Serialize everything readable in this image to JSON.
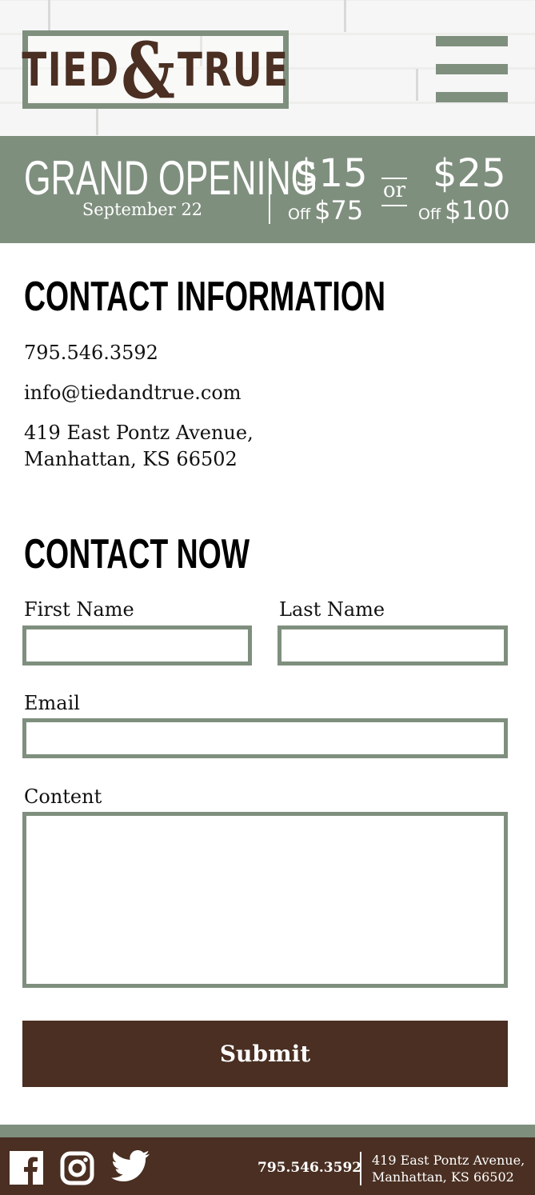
{
  "brand": {
    "logo_text_left": "TIED",
    "logo_amp": "&",
    "logo_text_right": "TRUE",
    "brown": "#4a2f22",
    "sage": "#7f8f7e"
  },
  "header": {
    "menu_icon": "hamburger-menu-icon"
  },
  "promo": {
    "title": "GRAND OPENING",
    "date": "September 22",
    "deal1_amount": "$15",
    "deal1_off": "Off",
    "deal1_min": "$75",
    "or": "or",
    "deal2_amount": "$25",
    "deal2_off": "Off",
    "deal2_min": "$100"
  },
  "contact_info": {
    "heading": "CONTACT INFORMATION",
    "phone": "795.546.3592",
    "email": "info@tiedandtrue.com",
    "address_line1": "419 East Pontz Avenue,",
    "address_line2": "Manhattan, KS 66502"
  },
  "contact_form": {
    "heading": "CONTACT NOW",
    "first_name_label": "First Name",
    "first_name_value": "",
    "last_name_label": "Last Name",
    "last_name_value": "",
    "email_label": "Email",
    "email_value": "",
    "content_label": "Content",
    "content_value": "",
    "submit_label": "Submit"
  },
  "footer": {
    "social_icons": [
      "facebook-icon",
      "instagram-icon",
      "twitter-icon"
    ],
    "phone": "795.546.3592",
    "address_line1": "419 East Pontz Avenue,",
    "address_line2": "Manhattan, KS 66502"
  }
}
